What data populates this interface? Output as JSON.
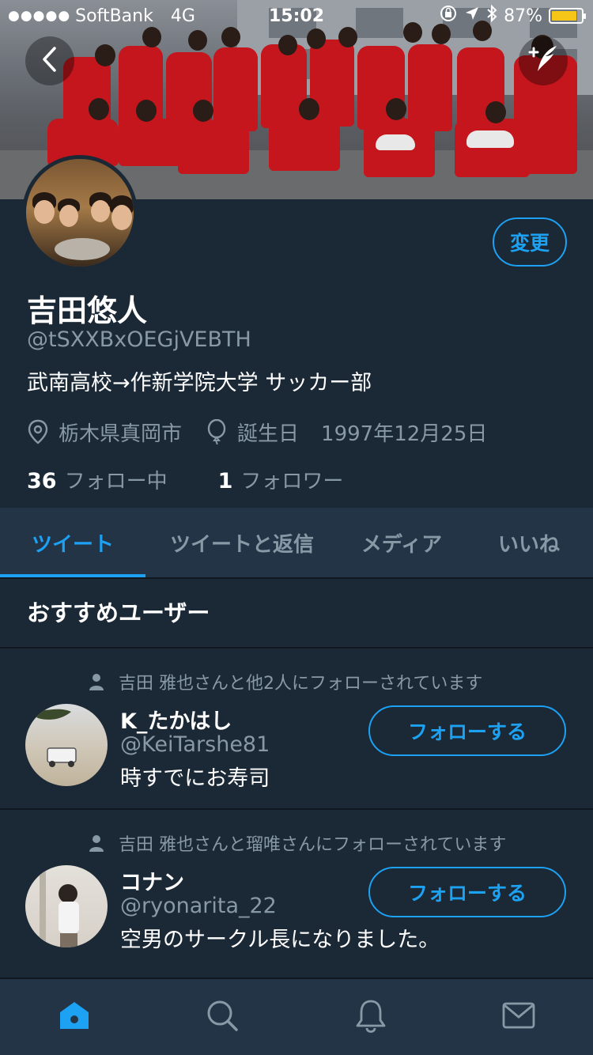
{
  "status_bar": {
    "signal_dots": "●●●●●",
    "carrier": "SoftBank",
    "network": "4G",
    "time": "15:02",
    "battery_percent": "87%",
    "battery_level": 0.87,
    "battery_color": "#f5c518"
  },
  "header": {
    "back_icon": "chevron-left-icon",
    "compose_icon": "compose-tweet-icon"
  },
  "profile": {
    "edit_label": "変更",
    "name": "吉田悠人",
    "handle": "@tSXXBxOEGjVEBTH",
    "bio": "武南高校→作新学院大学 サッカー部",
    "location": "栃木県真岡市",
    "birthday_label": "誕生日",
    "birthday": "1997年12月25日",
    "following_count": "36",
    "following_label": "フォロー中",
    "followers_count": "1",
    "followers_label": "フォロワー"
  },
  "tabs": [
    {
      "label": "ツイート",
      "active": true
    },
    {
      "label": "ツイートと返信",
      "active": false
    },
    {
      "label": "メディア",
      "active": false
    },
    {
      "label": "いいね",
      "active": false
    }
  ],
  "suggestions": {
    "title": "おすすめユーザー",
    "users": [
      {
        "social_context": "吉田 雅也さんと他2人にフォローされています",
        "name": "K_たかはし",
        "handle": "@KeiTarshe81",
        "bio": "時すでにお寿司",
        "follow_label": "フォローする"
      },
      {
        "social_context": "吉田 雅也さんと瑠唯さんにフォローされています",
        "name": "コナン",
        "handle": "@ryonarita_22",
        "bio": "空男のサークル長になりました。",
        "follow_label": "フォローする"
      }
    ]
  },
  "bottom_nav": {
    "items": [
      "home-icon",
      "search-icon",
      "notifications-icon",
      "messages-icon"
    ],
    "active": "home-icon"
  },
  "colors": {
    "background": "#1b2836",
    "panel": "#243447",
    "accent": "#1da1f2",
    "secondary_text": "#8899a6"
  }
}
